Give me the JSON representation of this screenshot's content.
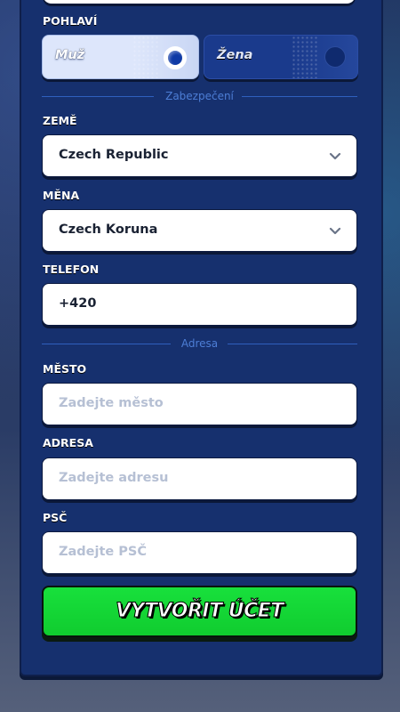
{
  "gender": {
    "label": "POHLAVÍ",
    "options": [
      {
        "label": "Muž",
        "selected": true
      },
      {
        "label": "Žena",
        "selected": false
      }
    ]
  },
  "security_divider": "Zabezpečení",
  "country": {
    "label": "ZEMĚ",
    "value": "Czech Republic"
  },
  "currency": {
    "label": "MĚNA",
    "value": "Czech Koruna"
  },
  "phone": {
    "label": "TELEFON",
    "value": "+420"
  },
  "address_divider": "Adresa",
  "city": {
    "label": "MĚSTO",
    "placeholder": "Zadejte město"
  },
  "address": {
    "label": "ADRESA",
    "placeholder": "Zadejte adresu"
  },
  "postcode": {
    "label": "PSČ",
    "placeholder": "Zadejte PSČ"
  },
  "submit_label": "VYTVOŘIT ÚČET",
  "colors": {
    "panel": "#16306e",
    "accent_green": "#14d935",
    "divider": "#4d7ed6"
  }
}
